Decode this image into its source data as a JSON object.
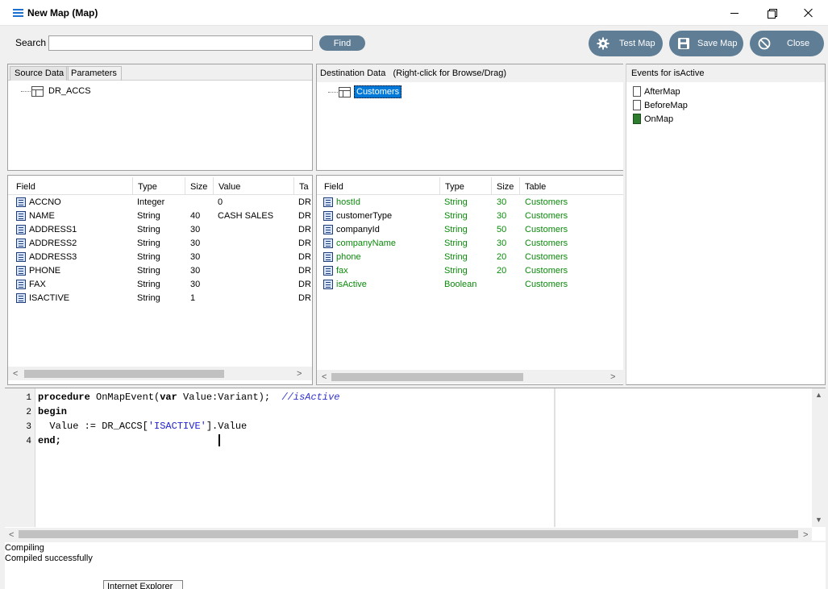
{
  "window": {
    "title": "New Map (Map)"
  },
  "toolbar": {
    "search_label": "Search",
    "search_value": "",
    "find_label": "Find",
    "test_map_label": "Test Map",
    "save_map_label": "Save Map",
    "close_label": "Close"
  },
  "source": {
    "tabs": [
      "Source Data",
      "Parameters"
    ],
    "tree_root": "DR_ACCS",
    "columns": [
      "Field",
      "Type",
      "Size",
      "Value",
      "Ta"
    ],
    "rows": [
      {
        "field": "ACCNO",
        "type": "Integer",
        "size": "",
        "value": "0",
        "table": "DR"
      },
      {
        "field": "NAME",
        "type": "String",
        "size": "40",
        "value": "CASH SALES",
        "table": "DR"
      },
      {
        "field": "ADDRESS1",
        "type": "String",
        "size": "30",
        "value": "",
        "table": "DR"
      },
      {
        "field": "ADDRESS2",
        "type": "String",
        "size": "30",
        "value": "",
        "table": "DR"
      },
      {
        "field": "ADDRESS3",
        "type": "String",
        "size": "30",
        "value": "",
        "table": "DR"
      },
      {
        "field": "PHONE",
        "type": "String",
        "size": "30",
        "value": "",
        "table": "DR"
      },
      {
        "field": "FAX",
        "type": "String",
        "size": "30",
        "value": "",
        "table": "DR"
      },
      {
        "field": "ISACTIVE",
        "type": "String",
        "size": "1",
        "value": "",
        "table": "DR"
      }
    ]
  },
  "destination": {
    "header": "Destination Data   (Right-click for Browse/Drag)",
    "tree_root": "Customers",
    "columns": [
      "Field",
      "Type",
      "Size",
      "Table"
    ],
    "rows": [
      {
        "field": "hostId",
        "type": "String",
        "size": "30",
        "table": "Customers",
        "mapped": true
      },
      {
        "field": "customerType",
        "type": "String",
        "size": "30",
        "table": "Customers",
        "mapped": false
      },
      {
        "field": "companyId",
        "type": "String",
        "size": "50",
        "table": "Customers",
        "mapped": false
      },
      {
        "field": "companyName",
        "type": "String",
        "size": "30",
        "table": "Customers",
        "mapped": true
      },
      {
        "field": "phone",
        "type": "String",
        "size": "20",
        "table": "Customers",
        "mapped": true
      },
      {
        "field": "fax",
        "type": "String",
        "size": "20",
        "table": "Customers",
        "mapped": true
      },
      {
        "field": "isActive",
        "type": "Boolean",
        "size": "",
        "table": "Customers",
        "mapped": true
      }
    ]
  },
  "events": {
    "header": "Events for isActive",
    "items": [
      {
        "label": "AfterMap",
        "active": false
      },
      {
        "label": "BeforeMap",
        "active": false
      },
      {
        "label": "OnMap",
        "active": true
      }
    ]
  },
  "editor": {
    "line_numbers": [
      "1",
      "2",
      "3",
      "4"
    ],
    "line1_kw1": "procedure",
    "line1_mid": " OnMapEvent(",
    "line1_kw2": "var",
    "line1_rest": " Value:Variant);  ",
    "line1_comment": "//isActive",
    "line2_kw": "begin",
    "line3_pre": "  Value := DR_ACCS[",
    "line3_str": "'ISACTIVE'",
    "line3_post": "].Value",
    "line4_kw": "end;"
  },
  "output": {
    "lines": [
      "Compiling",
      "Compiled successfully"
    ],
    "tooltip": "Internet Explorer"
  },
  "colors": {
    "accent_button": "#5f7d95",
    "mapped_green": "#0a8a0a",
    "selection_blue": "#0078d7"
  }
}
